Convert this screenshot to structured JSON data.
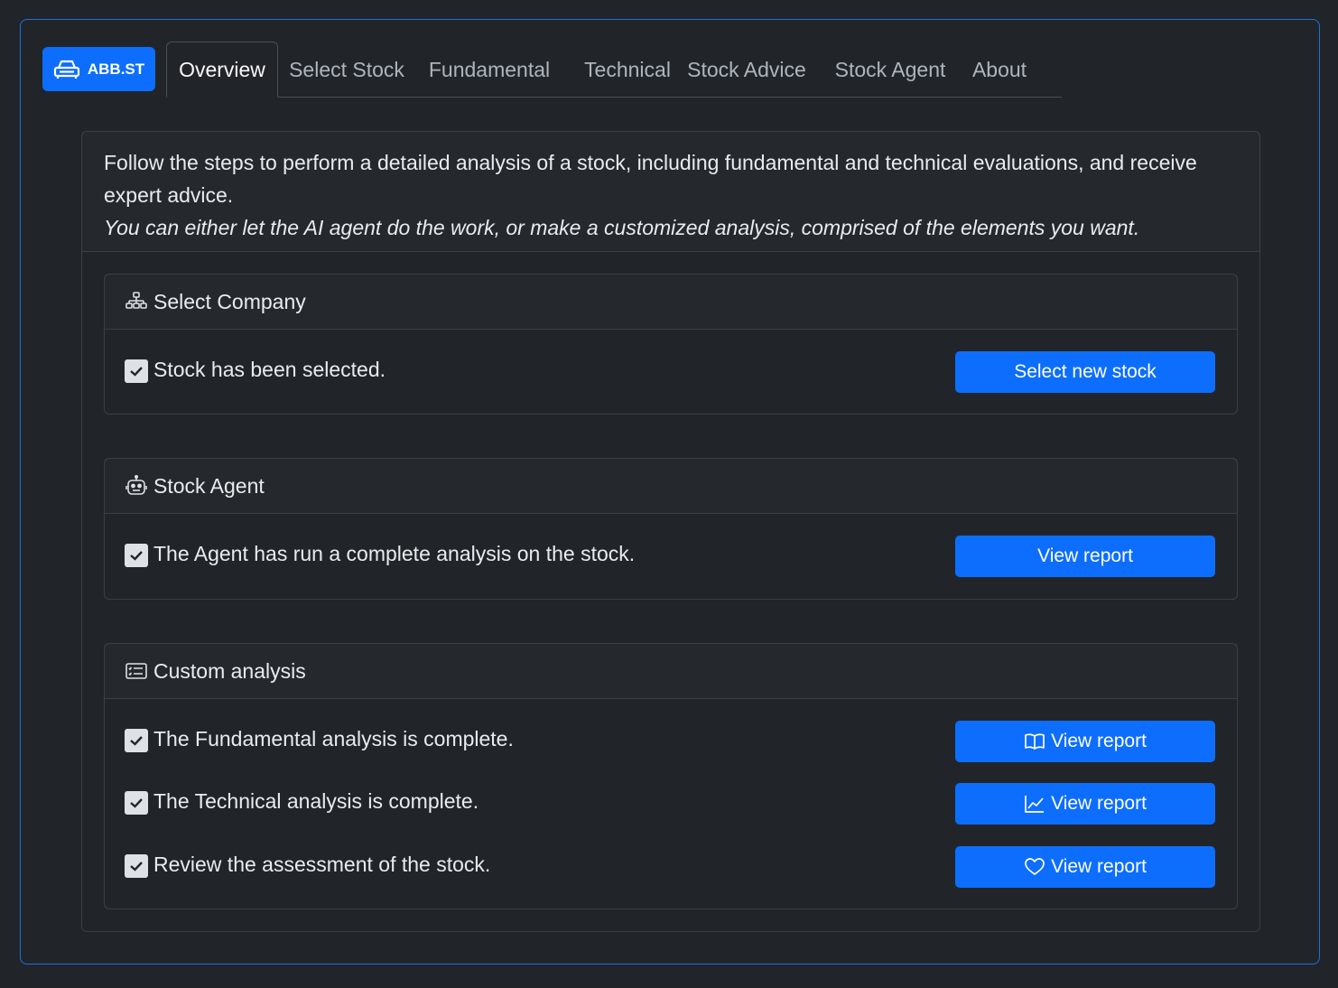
{
  "brand": {
    "label": "ABB.ST",
    "icon": "car-icon"
  },
  "tabs": [
    {
      "label": "Overview",
      "active": true
    },
    {
      "label": "Select Stock"
    },
    {
      "label": "Fundamental"
    },
    {
      "label": "Technical"
    },
    {
      "label": "Stock Advice"
    },
    {
      "label": "Stock Agent"
    },
    {
      "label": "About"
    }
  ],
  "intro": {
    "text": "Follow the steps to perform a detailed analysis of a stock, including fundamental and technical evaluations, and receive expert advice.",
    "italic": "You can either let the AI agent do the work, or make a customized analysis, comprised of the elements you want."
  },
  "sections": [
    {
      "title": "Select Company",
      "icon": "diagram-icon",
      "rows": [
        {
          "text": "Stock has been selected.",
          "checked": true,
          "button": "Select new stock",
          "button_icon": ""
        }
      ]
    },
    {
      "title": "Stock Agent",
      "icon": "robot-icon",
      "rows": [
        {
          "text": "The Agent has run a complete analysis on the stock.",
          "checked": true,
          "button": "View report",
          "button_icon": ""
        }
      ]
    },
    {
      "title": "Custom analysis",
      "icon": "card-list-icon",
      "rows": [
        {
          "text": "The Fundamental analysis is complete.",
          "checked": true,
          "button": "View report",
          "button_icon": "book-icon"
        },
        {
          "text": "The Technical analysis is complete.",
          "checked": true,
          "button": "View report",
          "button_icon": "graph-icon"
        },
        {
          "text": "Review the assessment of the stock.",
          "checked": true,
          "button": "View report",
          "button_icon": "heart-icon"
        }
      ]
    }
  ],
  "colors": {
    "accent": "#0d6efd",
    "background": "#212529",
    "border_frame": "#1d6fe0"
  }
}
